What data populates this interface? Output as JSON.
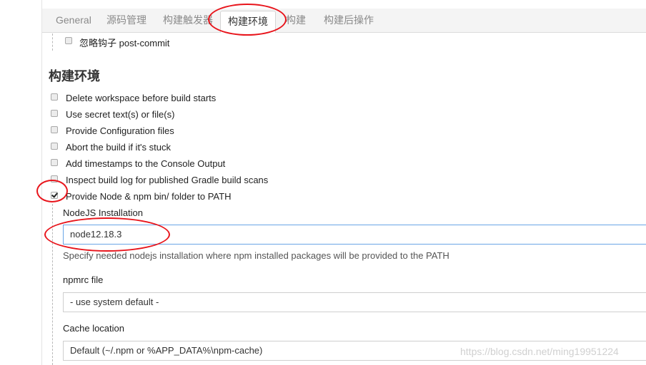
{
  "tabs": [
    {
      "id": "general",
      "label": "General"
    },
    {
      "id": "scm",
      "label": "源码管理"
    },
    {
      "id": "triggers",
      "label": "构建触发器"
    },
    {
      "id": "env",
      "label": "构建环境"
    },
    {
      "id": "build",
      "label": "构建"
    },
    {
      "id": "post",
      "label": "构建后操作"
    }
  ],
  "trigger_option": {
    "label": "忽略钩子 post-commit",
    "checked": false
  },
  "section": {
    "title": "构建环境"
  },
  "env_options": [
    {
      "label": "Delete workspace before build starts",
      "checked": false
    },
    {
      "label": "Use secret text(s) or file(s)",
      "checked": false
    },
    {
      "label": "Provide Configuration files",
      "checked": false
    },
    {
      "label": "Abort the build if it's stuck",
      "checked": false
    },
    {
      "label": "Add timestamps to the Console Output",
      "checked": false
    },
    {
      "label": "Inspect build log for published Gradle build scans",
      "checked": false
    },
    {
      "label": "Provide Node & npm bin/ folder to PATH",
      "checked": true
    }
  ],
  "node": {
    "installation_label": "NodeJS Installation",
    "installation_value": "node12.18.3",
    "installation_help": "Specify needed nodejs installation where npm installed packages will be provided to the PATH",
    "npmrc_label": "npmrc file",
    "npmrc_value": "- use system default -",
    "cache_label": "Cache location",
    "cache_value": "Default (~/.npm or %APP_DATA%\\npm-cache)"
  },
  "watermark": "https://blog.csdn.net/ming19951224",
  "colors": {
    "annotation": "#e8141b",
    "focus": "#6aa5e6"
  }
}
